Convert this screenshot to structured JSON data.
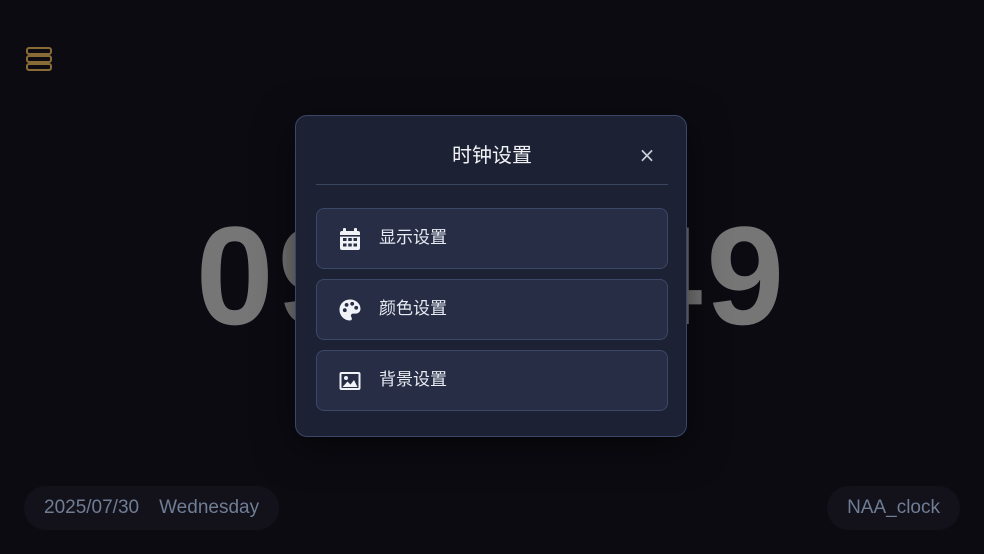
{
  "clock": {
    "time": "09:23:49"
  },
  "footer": {
    "date": "2025/07/30",
    "weekday": "Wednesday",
    "brand": "NAA_clock"
  },
  "modal": {
    "title": "时钟设置",
    "close_label": "×",
    "options": [
      {
        "label": "显示设置",
        "icon": "calendar-icon"
      },
      {
        "label": "颜色设置",
        "icon": "palette-icon"
      },
      {
        "label": "背景设置",
        "icon": "image-icon"
      }
    ]
  },
  "colors": {
    "menu_icon": "#a07d3c",
    "clock": "#8a8a8a",
    "modal_bg": "#1c2133",
    "option_bg": "#262d45",
    "footer_text": "#6f7d95"
  }
}
